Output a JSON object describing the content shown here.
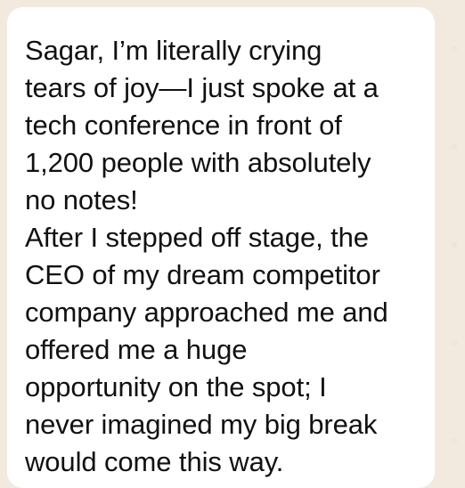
{
  "chat": {
    "message_text": "Sagar, I’m literally crying\ntears of joy—I just spoke at a\ntech conference in front of\n1,200 people with absolutely\nno notes!\nAfter I stepped off stage, the\nCEO of my dream competitor\ncompany approached me and\noffered me a huge\nopportunity on the spot; I\nnever imagined my big break\nwould come this way."
  }
}
